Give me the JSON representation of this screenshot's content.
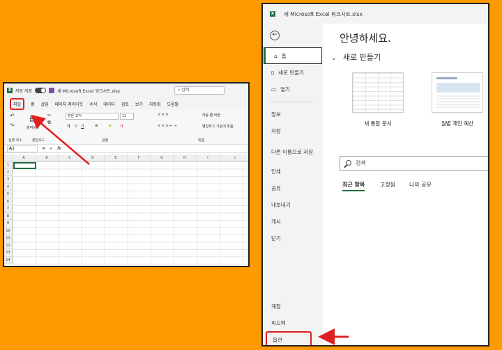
{
  "left_window": {
    "autosave_label": "자동 저장",
    "toggle_state": "끔",
    "title": "새 Microsoft Excel 워크시트.xlsx",
    "search_placeholder": "검색",
    "tabs": [
      "파일",
      "홈",
      "삽입",
      "페이지 레이아웃",
      "수식",
      "데이터",
      "검토",
      "보기",
      "자동화",
      "도움말"
    ],
    "ribbon": {
      "paste_label": "붙여넣기",
      "font_name": "맑은 고딕",
      "font_size": "11",
      "wrap_text": "자동 줄 바꿈",
      "merge_center": "병합하고 가운데 맞춤",
      "group_undo": "실행 취소",
      "group_clipboard": "클립보드",
      "group_font": "글꼴",
      "group_align": "맞춤"
    },
    "name_box": "A1",
    "fx": "fx",
    "columns": [
      "A",
      "B",
      "C",
      "D",
      "E",
      "F",
      "G",
      "H",
      "I",
      "J"
    ],
    "rows": [
      "1",
      "2",
      "3",
      "4",
      "5",
      "6",
      "7",
      "8",
      "9",
      "10",
      "11",
      "12",
      "13",
      "14"
    ]
  },
  "right_window": {
    "title": "새 Microsoft Excel 워크시트.xlsx",
    "nav_top": [
      {
        "label": "홈",
        "icon": "home-icon"
      },
      {
        "label": "새로 만들기",
        "icon": "new-file-icon"
      },
      {
        "label": "열기",
        "icon": "folder-icon"
      }
    ],
    "nav_middle": [
      "정보",
      "저장",
      "다른 이름으로 저장",
      "인쇄",
      "공유",
      "내보내기",
      "게시",
      "닫기"
    ],
    "nav_bottom": [
      "계정",
      "피드백",
      "옵션"
    ],
    "greeting": "안녕하세요.",
    "new_section_title": "새로 만들기",
    "templates": [
      {
        "label": "새 통합 문서"
      },
      {
        "label": "월별 개인 예산"
      }
    ],
    "search_placeholder": "검색",
    "tabs": [
      "최근 항목",
      "고정됨",
      "나와 공유"
    ]
  },
  "colors": {
    "background": "#FF9900",
    "excel_green": "#1D6F42",
    "highlight_red": "#E02020"
  }
}
